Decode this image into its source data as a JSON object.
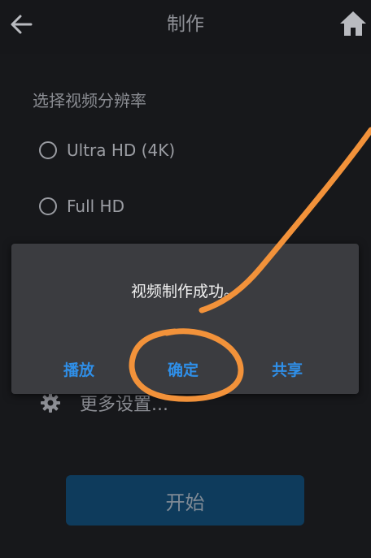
{
  "header": {
    "title": "制作",
    "back_icon": "arrow-left-icon",
    "home_icon": "home-icon"
  },
  "resolution": {
    "label": "选择视频分辨率",
    "options": [
      {
        "label": "Ultra HD (4K)",
        "selected": false
      },
      {
        "label": "Full HD",
        "selected": false
      }
    ]
  },
  "more_settings": {
    "icon": "gear-icon",
    "label": "更多设置..."
  },
  "start_button": {
    "label": "开始"
  },
  "dialog": {
    "message": "视频制作成功。",
    "buttons": {
      "play": "播放",
      "confirm": "确定",
      "share": "共享"
    }
  },
  "colors": {
    "accent": "#2f8fe8",
    "annotation": "#f2923a",
    "dialog_bg": "#3b3c40",
    "start_button_bg": "#0e3b5c"
  }
}
